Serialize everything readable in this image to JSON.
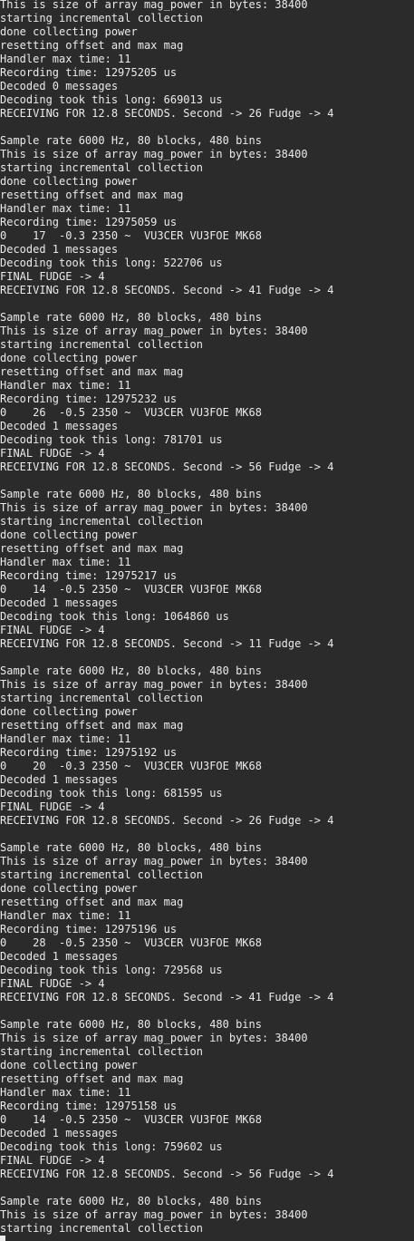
{
  "terminal": {
    "lines": [
      "This is size of array mag_power in bytes: 38400",
      "starting incremental collection",
      "done collecting power",
      "resetting offset and max mag",
      "Handler max time: 11",
      "Recording time: 12975205 us",
      "Decoded 0 messages",
      "Decoding took this long: 669013 us",
      "RECEIVING FOR 12.8 SECONDS. Second -> 26 Fudge -> 4",
      "",
      "Sample rate 6000 Hz, 80 blocks, 480 bins",
      "This is size of array mag_power in bytes: 38400",
      "starting incremental collection",
      "done collecting power",
      "resetting offset and max mag",
      "Handler max time: 11",
      "Recording time: 12975059 us",
      "0    17  -0.3 2350 ~  VU3CER VU3FOE MK68",
      "Decoded 1 messages",
      "Decoding took this long: 522706 us",
      "FINAL FUDGE -> 4",
      "RECEIVING FOR 12.8 SECONDS. Second -> 41 Fudge -> 4",
      "",
      "Sample rate 6000 Hz, 80 blocks, 480 bins",
      "This is size of array mag_power in bytes: 38400",
      "starting incremental collection",
      "done collecting power",
      "resetting offset and max mag",
      "Handler max time: 11",
      "Recording time: 12975232 us",
      "0    26  -0.5 2350 ~  VU3CER VU3FOE MK68",
      "Decoded 1 messages",
      "Decoding took this long: 781701 us",
      "FINAL FUDGE -> 4",
      "RECEIVING FOR 12.8 SECONDS. Second -> 56 Fudge -> 4",
      "",
      "Sample rate 6000 Hz, 80 blocks, 480 bins",
      "This is size of array mag_power in bytes: 38400",
      "starting incremental collection",
      "done collecting power",
      "resetting offset and max mag",
      "Handler max time: 11",
      "Recording time: 12975217 us",
      "0    14  -0.5 2350 ~  VU3CER VU3FOE MK68",
      "Decoded 1 messages",
      "Decoding took this long: 1064860 us",
      "FINAL FUDGE -> 4",
      "RECEIVING FOR 12.8 SECONDS. Second -> 11 Fudge -> 4",
      "",
      "Sample rate 6000 Hz, 80 blocks, 480 bins",
      "This is size of array mag_power in bytes: 38400",
      "starting incremental collection",
      "done collecting power",
      "resetting offset and max mag",
      "Handler max time: 11",
      "Recording time: 12975192 us",
      "0    20  -0.3 2350 ~  VU3CER VU3FOE MK68",
      "Decoded 1 messages",
      "Decoding took this long: 681595 us",
      "FINAL FUDGE -> 4",
      "RECEIVING FOR 12.8 SECONDS. Second -> 26 Fudge -> 4",
      "",
      "Sample rate 6000 Hz, 80 blocks, 480 bins",
      "This is size of array mag_power in bytes: 38400",
      "starting incremental collection",
      "done collecting power",
      "resetting offset and max mag",
      "Handler max time: 11",
      "Recording time: 12975196 us",
      "0    28  -0.5 2350 ~  VU3CER VU3FOE MK68",
      "Decoded 1 messages",
      "Decoding took this long: 729568 us",
      "FINAL FUDGE -> 4",
      "RECEIVING FOR 12.8 SECONDS. Second -> 41 Fudge -> 4",
      "",
      "Sample rate 6000 Hz, 80 blocks, 480 bins",
      "This is size of array mag_power in bytes: 38400",
      "starting incremental collection",
      "done collecting power",
      "resetting offset and max mag",
      "Handler max time: 11",
      "Recording time: 12975158 us",
      "0    14  -0.5 2350 ~  VU3CER VU3FOE MK68",
      "Decoded 1 messages",
      "Decoding took this long: 759602 us",
      "FINAL FUDGE -> 4",
      "RECEIVING FOR 12.8 SECONDS. Second -> 56 Fudge -> 4",
      "",
      "Sample rate 6000 Hz, 80 blocks, 480 bins",
      "This is size of array mag_power in bytes: 38400",
      "starting incremental collection"
    ]
  },
  "colors": {
    "background": "#2b2b2b",
    "foreground": "#eaeaea"
  }
}
